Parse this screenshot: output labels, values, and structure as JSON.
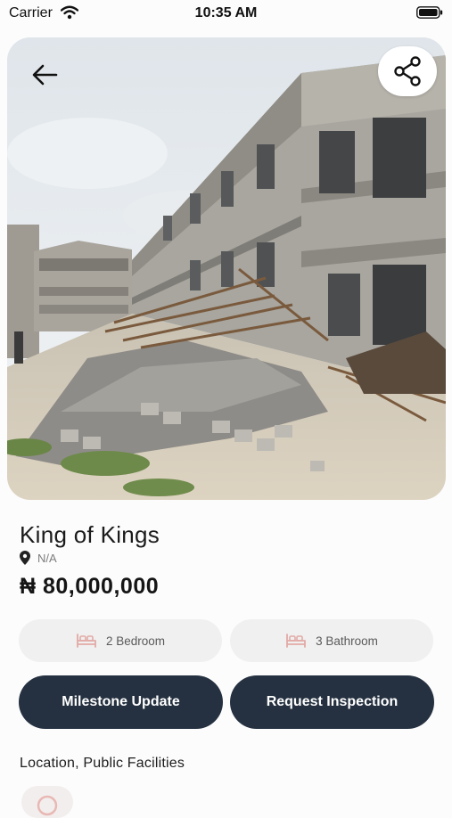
{
  "status_bar": {
    "carrier": "Carrier",
    "time": "10:35 AM",
    "icons": [
      "wifi-icon",
      "battery-icon"
    ]
  },
  "hero": {
    "image": "construction site photo",
    "back_icon": "arrow-left-icon",
    "share_icon": "share-icon"
  },
  "property": {
    "name": "King of Kings",
    "location_icon": "location-pin-icon",
    "location": "N/A",
    "price": "₦ 80,000,000"
  },
  "features": [
    {
      "icon": "bed-icon",
      "label": "2 Bedroom"
    },
    {
      "icon": "bed-icon",
      "label": "3 Bathroom"
    }
  ],
  "actions": {
    "milestone": "Milestone Update",
    "inspection": "Request Inspection"
  },
  "section": {
    "title": "Location, Public Facilities"
  },
  "colors": {
    "primary": "#253140",
    "chip_background": "#f0f0f0",
    "chip_icon": "#e2aaa6",
    "muted_text": "#7d7d7d"
  }
}
